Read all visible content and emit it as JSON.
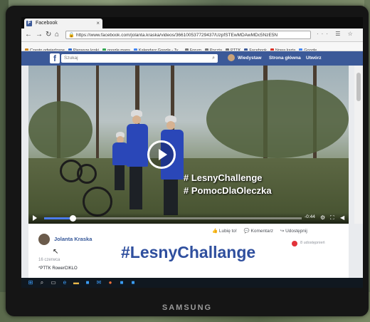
{
  "device": {
    "brand": "SAMSUNG"
  },
  "browser": {
    "tab_title": "Facebook",
    "tab_favicon": "F",
    "tab_close": "×",
    "nav": {
      "back": "←",
      "forward": "→",
      "reload": "↻",
      "home": "⌂"
    },
    "url": "https://www.facebook.com/jolanta.kraska/videos/366100537729437/UzpfSTEwMDAwMDc5NzE5N",
    "tools_text": "··· ☰ ☆",
    "bookmarks": [
      {
        "label": "Często odwiedzane",
        "color": "#d08a1e"
      },
      {
        "label": "Pierwsze kroki",
        "color": "#2e6bd1"
      },
      {
        "label": "google maps",
        "color": "#34a853"
      },
      {
        "label": "Kalendarz Google - Ty...",
        "color": "#4285f4"
      },
      {
        "label": "Forum",
        "color": "#777777"
      },
      {
        "label": "Poczta",
        "color": "#777777"
      },
      {
        "label": "PTTK",
        "color": "#777777"
      },
      {
        "label": "Facebook",
        "color": "#3b5998"
      },
      {
        "label": "Nowa karta",
        "color": "#d93025"
      },
      {
        "label": "Google",
        "color": "#4285f4"
      }
    ]
  },
  "facebook": {
    "logo": "f",
    "search_placeholder": "Szukaj",
    "search_icon": "⌕",
    "nav": [
      "Wiedystaw",
      "Strona główna",
      "Utwórz"
    ]
  },
  "video": {
    "overlay_lines": [
      "# LesnyChallenge",
      "# PomocDlaOleczka"
    ],
    "progress_fraction": 0.11,
    "time_remaining": "-0:44",
    "gear_icon": "⚙",
    "fullscreen_icon": "⛶",
    "volume_icon": "◀"
  },
  "post": {
    "actions": [
      "👍 Lubię to!",
      "💬 Komentarz",
      "↪ Udostępnij"
    ],
    "author": "Jolanta Kraska",
    "shares_text": "8 udostępnień",
    "time_text": "16 czerwca",
    "caption": "*PTTK RowerCIKLO",
    "hashtag_overlay": "#LesnyChallange"
  }
}
